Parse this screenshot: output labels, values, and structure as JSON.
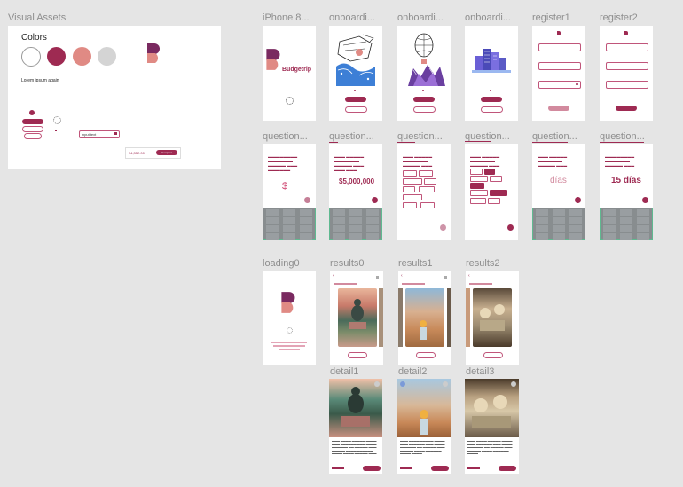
{
  "visual_assets": {
    "title": "Visual Assets",
    "colors_title": "Colors",
    "lorem": "Lorem ipsum again",
    "swatches": [
      "#ffffff",
      "#9e2a52",
      "#e08a84",
      "#d4d4d4"
    ],
    "field_value": "input text",
    "price": "$4,352.00",
    "button": "Comprar"
  },
  "frames": {
    "iphone": "iPhone 8...",
    "onb1": "onboardi...",
    "onb2": "onboardi...",
    "onb3": "onboardi...",
    "register1": "register1",
    "register2": "register2",
    "q1": "question...",
    "q2": "question...",
    "q3": "question...",
    "q4": "question...",
    "q5": "question...",
    "q6": "question...",
    "loading": "loading0",
    "results0": "results0",
    "results1": "results1",
    "results2": "results2",
    "detail1": "detail1",
    "detail2": "detail2",
    "detail3": "detail3"
  },
  "splash": {
    "brand": "Budgetrip"
  },
  "questions": {
    "q1_amount": "$",
    "q2_amount": "$5,000,000",
    "q5_days": "días",
    "q6_days": "15 días"
  },
  "colors": {
    "primary": "#9e2a52",
    "accent": "#e08a84",
    "keypad_border": "#5fb990"
  }
}
